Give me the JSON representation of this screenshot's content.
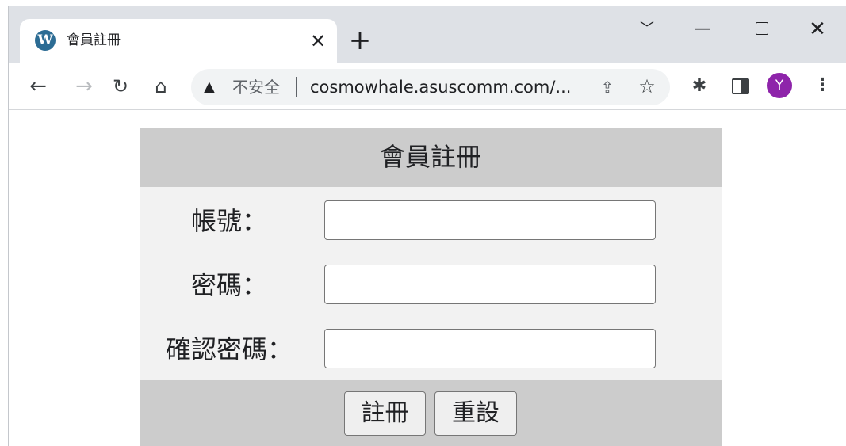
{
  "browser": {
    "tab": {
      "title": "會員註冊",
      "close_glyph": "✕"
    },
    "new_tab_glyph": "+",
    "window": {
      "tabsearch_glyph": "﹀",
      "minimize_glyph": "—",
      "close_glyph": "✕"
    },
    "toolbar": {
      "back_glyph": "←",
      "forward_glyph": "→",
      "reload_glyph": "↻",
      "home_glyph": "⌂",
      "security_warning_glyph": "▲",
      "security_text": "不安全",
      "url": "cosmowhale.asuscomm.com/...",
      "share_glyph": "⇪",
      "bookmark_glyph": "☆",
      "extensions_glyph": "✱",
      "profile_initial": "Y",
      "menu_glyph": "⋮"
    },
    "colors": {
      "tabstrip": "#dee1e6",
      "omnibox": "#f1f3f4",
      "avatar": "#8e24aa"
    }
  },
  "form": {
    "title": "會員註冊",
    "fields": [
      {
        "label": "帳號：",
        "value": ""
      },
      {
        "label": "密碼：",
        "value": ""
      },
      {
        "label": "確認密碼：",
        "value": ""
      }
    ],
    "submit_label": "註冊",
    "reset_label": "重設",
    "colors": {
      "header": "#cccccc",
      "body": "#f2f2f2"
    }
  }
}
